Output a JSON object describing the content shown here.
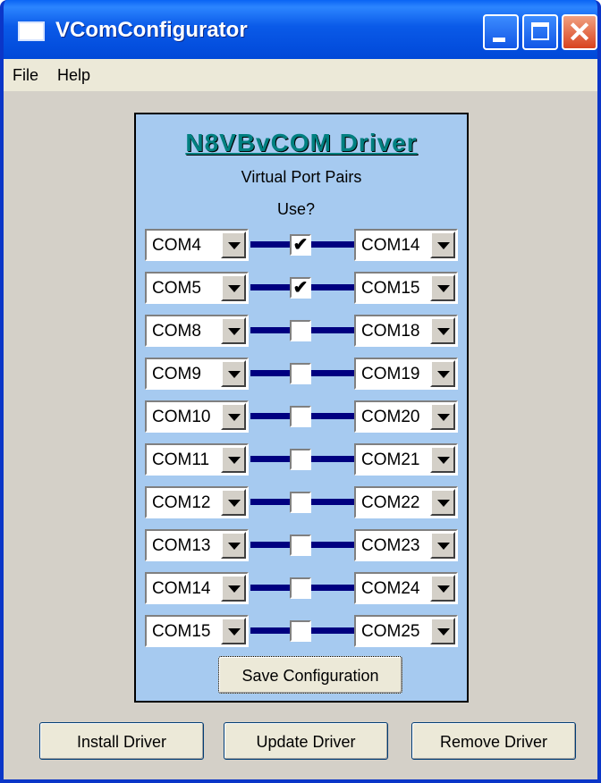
{
  "window": {
    "title": "VComConfigurator"
  },
  "menu": {
    "file": "File",
    "help": "Help"
  },
  "panel": {
    "heading": "N8VBvCOM Driver",
    "subheading": "Virtual Port Pairs",
    "use_label": "Use?",
    "pairs": [
      {
        "left": "COM4",
        "right": "COM14",
        "use": true
      },
      {
        "left": "COM5",
        "right": "COM15",
        "use": true
      },
      {
        "left": "COM8",
        "right": "COM18",
        "use": false
      },
      {
        "left": "COM9",
        "right": "COM19",
        "use": false
      },
      {
        "left": "COM10",
        "right": "COM20",
        "use": false
      },
      {
        "left": "COM11",
        "right": "COM21",
        "use": false
      },
      {
        "left": "COM12",
        "right": "COM22",
        "use": false
      },
      {
        "left": "COM13",
        "right": "COM23",
        "use": false
      },
      {
        "left": "COM14",
        "right": "COM24",
        "use": false
      },
      {
        "left": "COM15",
        "right": "COM25",
        "use": false
      }
    ],
    "save_label": "Save Configuration"
  },
  "buttons": {
    "install": "Install Driver",
    "update": "Update Driver",
    "remove": "Remove Driver"
  },
  "icons": {
    "checkmark": "✔",
    "close": "✕"
  },
  "colors": {
    "panel_bg": "#a6caf0",
    "link_line": "#000080",
    "heading": "#008080",
    "titlebar": "#0a5ae8"
  }
}
